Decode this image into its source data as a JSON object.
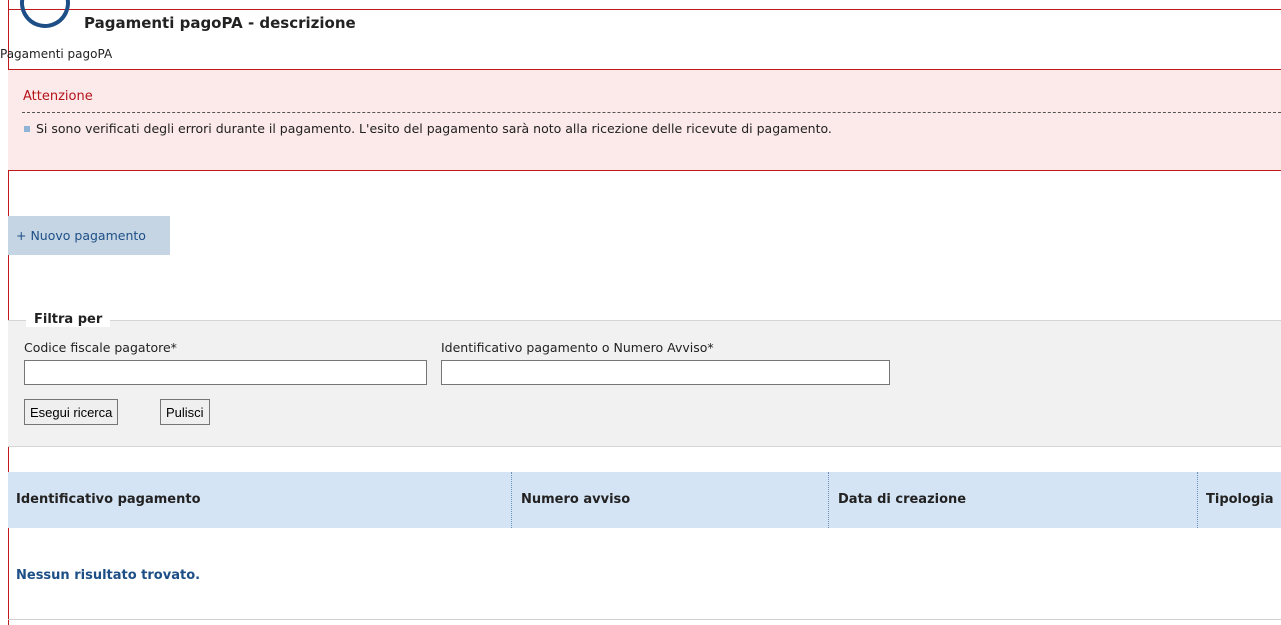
{
  "header": {
    "title": "Pagamenti pagoPA - descrizione",
    "breadcrumb": "Pagamenti pagoPA"
  },
  "alert": {
    "title": "Attenzione",
    "message": "Si sono verificati degli errori durante il pagamento. L'esito del pagamento sarà noto alla ricezione delle ricevute di pagamento."
  },
  "actions": {
    "new_payment": "+ Nuovo pagamento"
  },
  "filter": {
    "legend": "Filtra per",
    "fiscal_code_label": "Codice fiscale pagatore*",
    "fiscal_code_value": "",
    "payment_id_label": "Identificativo pagamento o Numero Avviso*",
    "payment_id_value": "",
    "search_button": "Esegui ricerca",
    "clear_button": "Pulisci"
  },
  "table": {
    "columns": [
      "Identificativo pagamento",
      "Numero avviso",
      "Data di creazione",
      "Tipologia"
    ],
    "empty_message": "Nessun risultato trovato."
  },
  "colors": {
    "alert_red": "#c0191c",
    "alert_bg": "#fce9e9",
    "link_blue": "#1d4f86",
    "table_header_bg": "#d5e4f4"
  }
}
